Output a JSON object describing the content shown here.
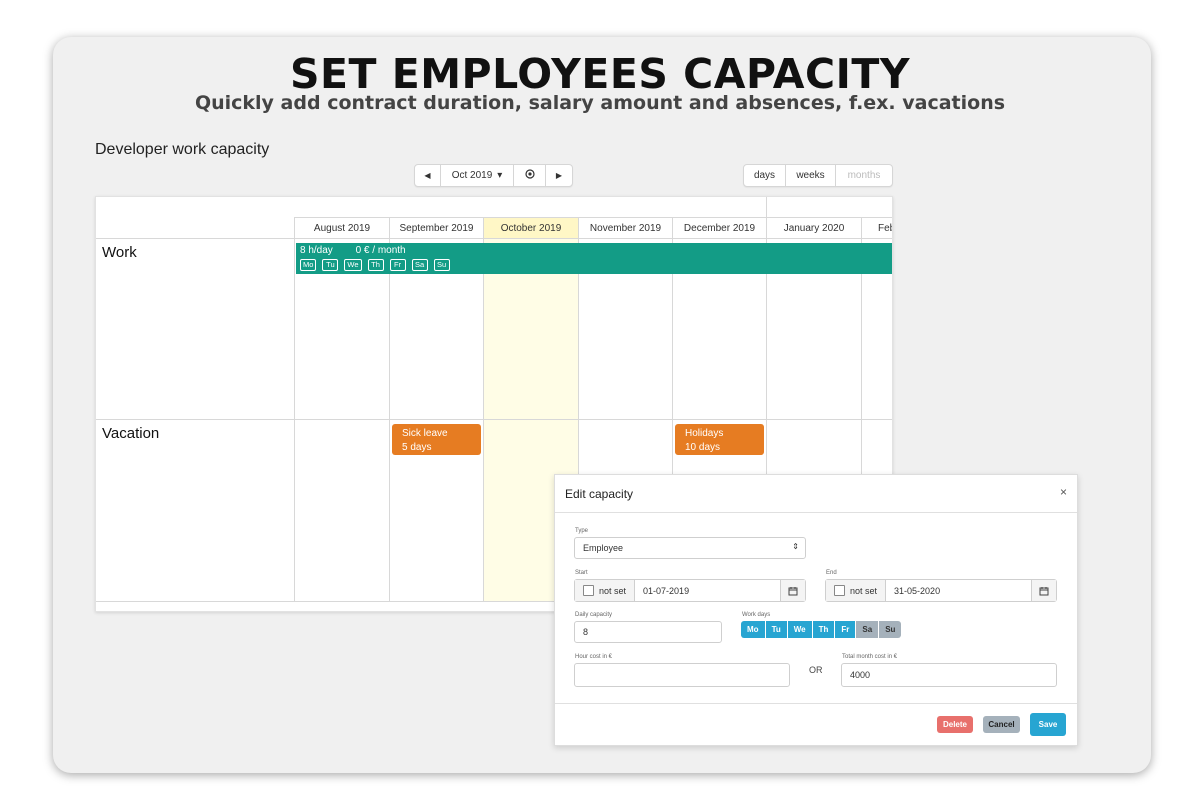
{
  "hero": {
    "title": "SET EMPLOYEES CAPACITY",
    "subtitle": "Quickly add contract duration, salary amount and absences, f.ex. vacations"
  },
  "section": {
    "title": "Developer work capacity"
  },
  "toolbar": {
    "prev_icon": "caret-left-icon",
    "period_label": "Oct 2019",
    "period_caret": "▾",
    "today_icon": "target-icon",
    "next_icon": "caret-right-icon",
    "views": [
      "days",
      "weeks",
      "months"
    ]
  },
  "timeline": {
    "months": [
      "August 2019",
      "September 2019",
      "October 2019",
      "November 2019",
      "December 2019",
      "January 2020",
      "Feb"
    ],
    "current_month": "October 2019",
    "rows": [
      {
        "label": "Work"
      },
      {
        "label": "Vacation"
      }
    ],
    "work_bar": {
      "hours": "8 h/day",
      "cost": "0 € / month",
      "days": [
        "Mo",
        "Tu",
        "We",
        "Th",
        "Fr",
        "Sa",
        "Su"
      ],
      "color": "#139c86"
    },
    "events": [
      {
        "title": "Sick leave",
        "duration": "5 days",
        "color": "#e67c22"
      },
      {
        "title": "Holidays",
        "duration": "10 days",
        "color": "#e67c22"
      }
    ]
  },
  "modal": {
    "title": "Edit capacity",
    "close": "×",
    "type": {
      "label": "Type",
      "value": "Employee",
      "arrow": "⇕"
    },
    "start": {
      "label": "Start",
      "not_set": "not set",
      "value": "01-07-2019"
    },
    "end": {
      "label": "End",
      "not_set": "not set",
      "value": "31-05-2020"
    },
    "daily_capacity": {
      "label": "Daily capacity",
      "value": "8"
    },
    "work_days": {
      "label": "Work days",
      "days": [
        {
          "label": "Mo",
          "active": true
        },
        {
          "label": "Tu",
          "active": true
        },
        {
          "label": "We",
          "active": true
        },
        {
          "label": "Th",
          "active": true
        },
        {
          "label": "Fr",
          "active": true
        },
        {
          "label": "Sa",
          "active": false
        },
        {
          "label": "Su",
          "active": false
        }
      ]
    },
    "hour_cost": {
      "label": "Hour cost in €",
      "value": ""
    },
    "or_label": "OR",
    "month_cost": {
      "label": "Total month cost in €",
      "value": "4000"
    },
    "buttons": {
      "delete": "Delete",
      "cancel": "Cancel",
      "save": "Save"
    },
    "colors": {
      "delete": "#e8706c",
      "cancel": "#a5b1bb",
      "save": "#27a5d2",
      "active_day": "#27a5d2"
    }
  }
}
